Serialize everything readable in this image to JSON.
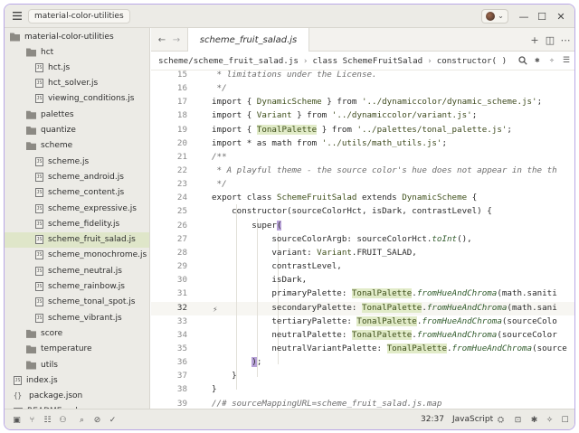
{
  "titlebar": {
    "project": "material-color-utilities",
    "menu_icon": "hamburger-icon",
    "chevron": "⌄",
    "minimize": "—",
    "maximize": "☐",
    "close": "✕"
  },
  "sidebar": {
    "root": "material-color-utilities",
    "items": [
      {
        "label": "hct",
        "kind": "folder",
        "open": true
      },
      {
        "label": "hct.js",
        "kind": "js"
      },
      {
        "label": "hct_solver.js",
        "kind": "js"
      },
      {
        "label": "viewing_conditions.js",
        "kind": "js"
      },
      {
        "label": "palettes",
        "kind": "folder",
        "open": false
      },
      {
        "label": "quantize",
        "kind": "folder",
        "open": false
      },
      {
        "label": "scheme",
        "kind": "folder",
        "open": true
      },
      {
        "label": "scheme.js",
        "kind": "js"
      },
      {
        "label": "scheme_android.js",
        "kind": "js"
      },
      {
        "label": "scheme_content.js",
        "kind": "js"
      },
      {
        "label": "scheme_expressive.js",
        "kind": "js"
      },
      {
        "label": "scheme_fidelity.js",
        "kind": "js"
      },
      {
        "label": "scheme_fruit_salad.js",
        "kind": "js",
        "active": true
      },
      {
        "label": "scheme_monochrome.js",
        "kind": "js"
      },
      {
        "label": "scheme_neutral.js",
        "kind": "js"
      },
      {
        "label": "scheme_rainbow.js",
        "kind": "js"
      },
      {
        "label": "scheme_tonal_spot.js",
        "kind": "js"
      },
      {
        "label": "scheme_vibrant.js",
        "kind": "js"
      },
      {
        "label": "score",
        "kind": "folder",
        "open": false
      },
      {
        "label": "temperature",
        "kind": "folder",
        "open": false
      },
      {
        "label": "utils",
        "kind": "folder",
        "open": false
      },
      {
        "label": "index.js",
        "kind": "js"
      },
      {
        "label": "package.json",
        "kind": "json"
      },
      {
        "label": "README.md",
        "kind": "md"
      }
    ]
  },
  "tabs": {
    "back": "←",
    "forward": "→",
    "active": "scheme_fruit_salad.js",
    "add": "+",
    "split": "◫",
    "more": "⋯"
  },
  "breadcrumb": {
    "path": "scheme/scheme_fruit_salad.js",
    "sep1": "›",
    "class": "class SchemeFruitSalad",
    "sep2": "›",
    "method": "constructor( )"
  },
  "editor": {
    "line_numbers": [
      "15",
      "16",
      "17",
      "18",
      "19",
      "20",
      "21",
      "22",
      "23",
      "24",
      "25",
      "26",
      "27",
      "28",
      "29",
      "30",
      "31",
      "32",
      "33",
      "34",
      "35",
      "36",
      "37",
      "38",
      "39"
    ],
    "current_line": "32"
  },
  "statusbar": {
    "cursor": "32:37",
    "language": "JavaScript"
  }
}
